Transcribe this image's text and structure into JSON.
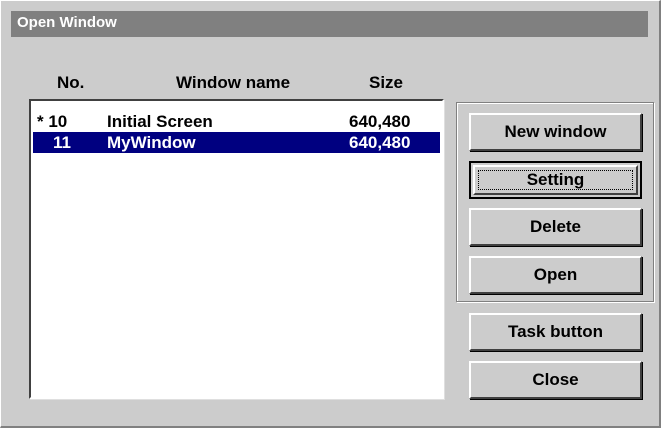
{
  "window": {
    "title": "Open Window"
  },
  "columns": {
    "no": "No.",
    "name": "Window name",
    "size": "Size"
  },
  "rows": [
    {
      "no": "* 10",
      "name": "Initial Screen",
      "size": "640,480",
      "selected": false
    },
    {
      "no": "11",
      "name": "MyWindow",
      "size": "640,480",
      "selected": true
    }
  ],
  "buttons": {
    "new_window": "New window",
    "setting": "Setting",
    "delete": "Delete",
    "open": "Open",
    "task_button": "Task button",
    "close": "Close"
  },
  "colors": {
    "dialog_bg": "#cccccc",
    "titlebar_bg": "#808080",
    "selection_bg": "#000080"
  }
}
